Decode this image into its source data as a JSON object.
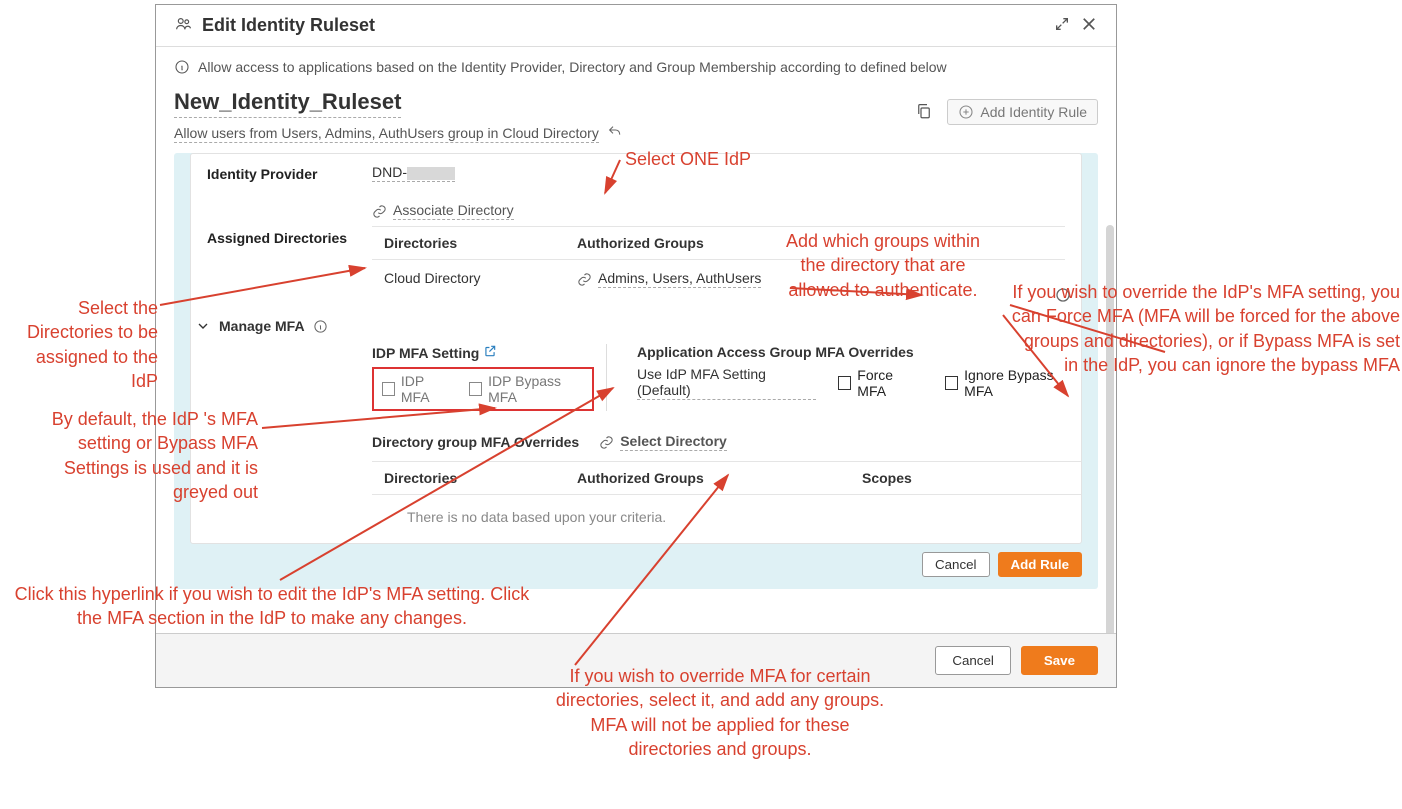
{
  "modal": {
    "title": "Edit Identity Ruleset",
    "description": "Allow access to applications based on the Identity Provider, Directory and Group Membership according to defined below",
    "ruleset_name": "New_Identity_Ruleset",
    "subtitle": "Allow users from Users, Admins, AuthUsers group in Cloud Directory",
    "add_rule_btn": "Add Identity Rule",
    "card": {
      "idp_label": "Identity Provider",
      "idp_value": "DND-",
      "assigned_label": "Assigned Directories",
      "associate_link": "Associate Directory",
      "col_directories": "Directories",
      "col_auth_groups": "Authorized Groups",
      "dir_value": "Cloud Directory",
      "groups_value": "Admins, Users, AuthUsers",
      "manage_mfa": "Manage MFA",
      "idp_mfa_title": "IDP MFA Setting",
      "idp_mfa_chk": "IDP MFA",
      "idp_bypass_chk": "IDP Bypass MFA",
      "app_override_title": "Application Access Group MFA Overrides",
      "use_default": "Use IdP MFA Setting (Default)",
      "force_mfa": "Force MFA",
      "ignore_bypass": "Ignore Bypass MFA",
      "dir_override_title": "Directory group MFA Overrides",
      "select_dir": "Select Directory",
      "col_scopes": "Scopes",
      "empty_msg": "There is no data based upon your criteria.",
      "cancel": "Cancel",
      "add_rule": "Add Rule"
    },
    "footer": {
      "cancel": "Cancel",
      "save": "Save"
    }
  },
  "annotations": {
    "a1": "Select ONE IdP",
    "a2": "Select the Directories to be assigned to the IdP",
    "a3": "Add which groups within the directory that are allowed to authenticate.",
    "a4": "By default, the IdP 's MFA setting or  Bypass MFA Settings  is used and it is greyed out",
    "a5": "Click this hyperlink if you wish to edit the IdP's MFA setting. Click the MFA section in the IdP to make any changes.",
    "a6": "If you wish to override MFA for certain directories, select it, and add  any groups. MFA will not be applied for these directories and groups.",
    "a7": "If you       wish to override the IdP's MFA setting, you can Force MFA  (MFA will be forced for the  above groups and directories), or if Bypass MFA is set in the IdP, you can ignore the bypass MFA"
  }
}
